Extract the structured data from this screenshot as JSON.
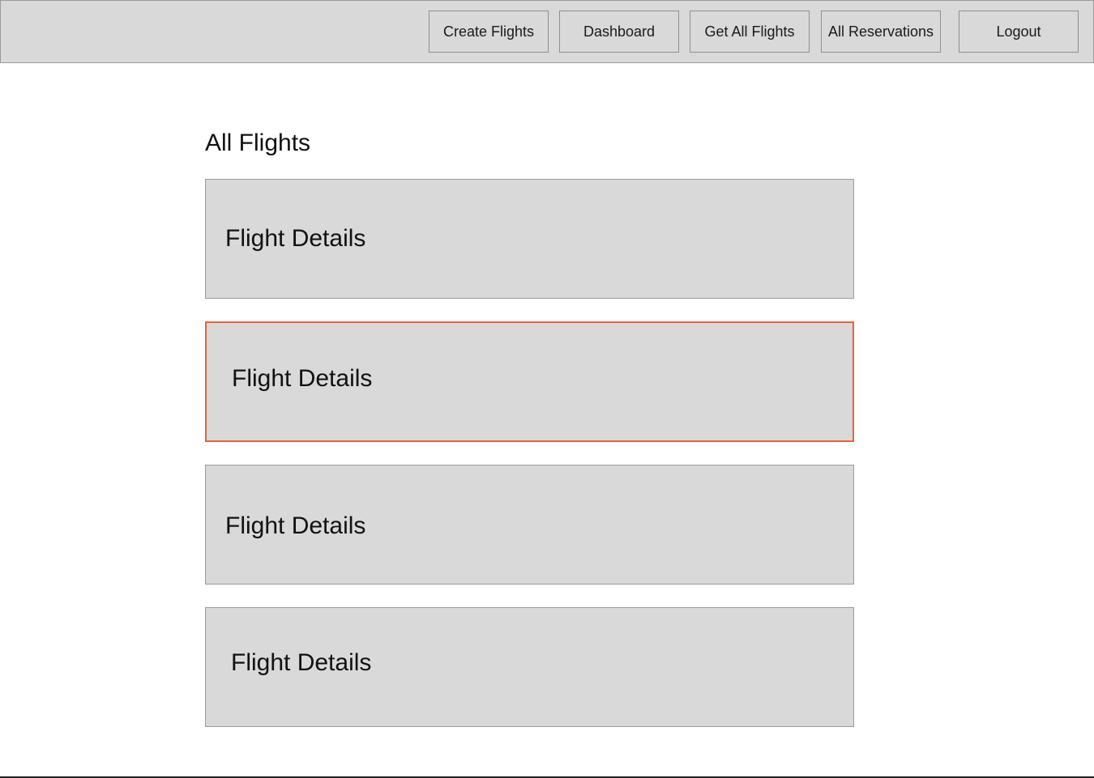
{
  "header": {
    "nav": [
      {
        "id": "create-flights",
        "label": "Create Flights"
      },
      {
        "id": "dashboard",
        "label": "Dashboard"
      },
      {
        "id": "get-all-flights",
        "label": "Get All Flights"
      },
      {
        "id": "all-reservations",
        "label": "All Reservations"
      },
      {
        "id": "logout",
        "label": "Logout"
      }
    ]
  },
  "main": {
    "title": "All Flights",
    "flights": [
      {
        "label": "Flight Details",
        "selected": false
      },
      {
        "label": "Flight Details",
        "selected": true
      },
      {
        "label": "Flight Details",
        "selected": false
      },
      {
        "label": "Flight Details",
        "selected": false
      }
    ]
  },
  "colors": {
    "background": "#ffffff",
    "panel": "#d9d9d9",
    "border": "#9a9a9a",
    "selected_accent": "#e8633a"
  }
}
